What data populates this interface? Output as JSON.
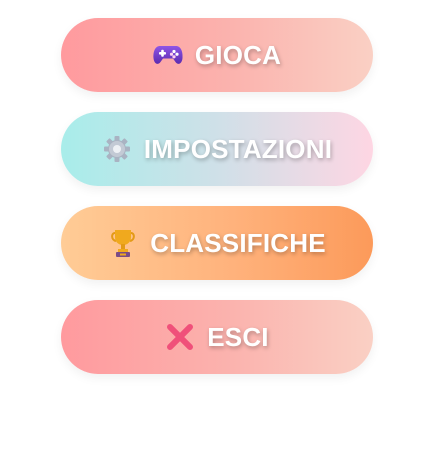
{
  "menu": {
    "items": [
      {
        "id": "play",
        "label": "GIOCA",
        "icon": "gamepad-icon",
        "gradient": [
          "#ff9a9e",
          "#fad0c4"
        ]
      },
      {
        "id": "settings",
        "label": "IMPOSTAZIONI",
        "icon": "gear-icon",
        "gradient": [
          "#a8edea",
          "#fed6e3"
        ]
      },
      {
        "id": "leaderboard",
        "label": "CLASSIFICHE",
        "icon": "trophy-icon",
        "gradient": [
          "#ffcc96",
          "#fc9a5a"
        ]
      },
      {
        "id": "exit",
        "label": "ESCI",
        "icon": "cross-icon",
        "gradient": [
          "#ff9a9e",
          "#fad0c4"
        ]
      }
    ]
  },
  "colors": {
    "label_text": "#ffffff",
    "icon_gamepad": "#7b3fd1",
    "icon_gear": "#a9b3c2",
    "icon_trophy": "#f0a91e",
    "icon_cross": "#f0507a"
  }
}
